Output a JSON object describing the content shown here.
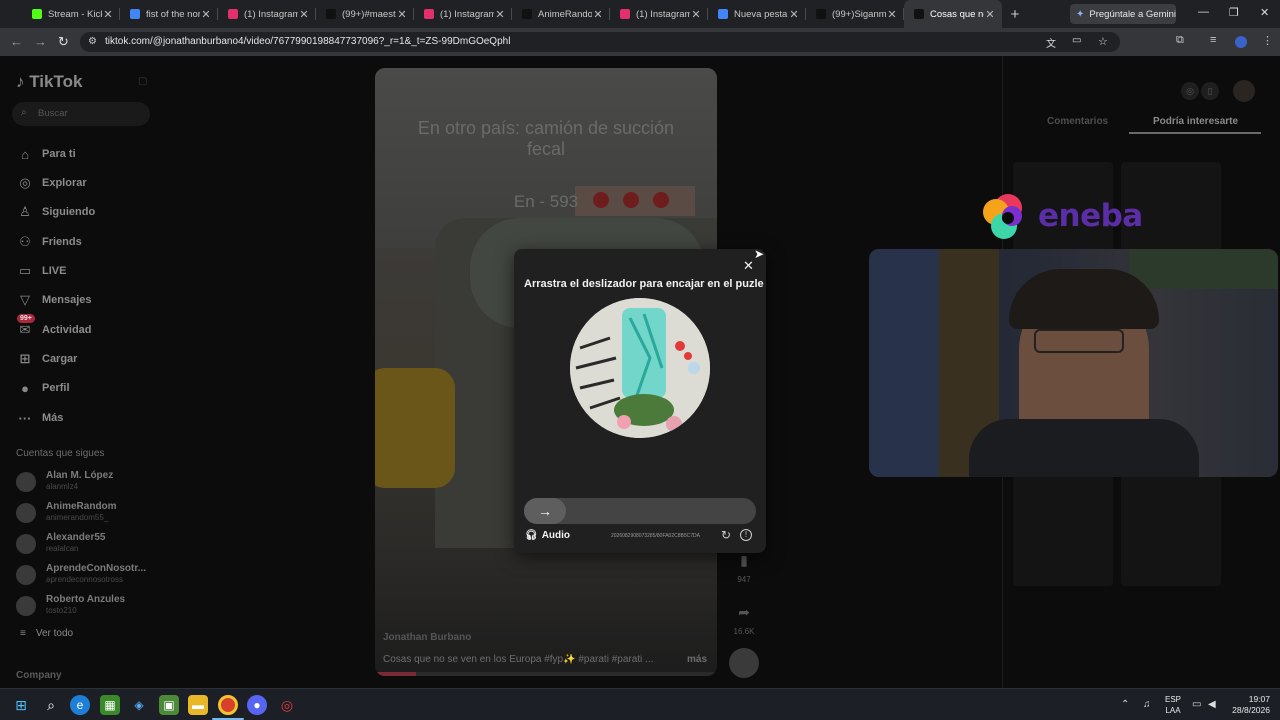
{
  "browser": {
    "tabs": [
      {
        "title": "Stream - Kick",
        "icon": "kick-icon",
        "color": "#53fc18"
      },
      {
        "title": "fist of the nort",
        "icon": "google-icon",
        "color": "#4285f4"
      },
      {
        "title": "(1) Instagram",
        "icon": "instagram-icon",
        "color": "#e1306c"
      },
      {
        "title": "(99+)#maestr",
        "icon": "tiktok-icon",
        "color": "#111111"
      },
      {
        "title": "(1) Instagram",
        "icon": "instagram-icon",
        "color": "#e1306c"
      },
      {
        "title": "AnimeRandom",
        "icon": "tiktok-icon",
        "color": "#111111"
      },
      {
        "title": "(1) Instagram",
        "icon": "instagram-icon",
        "color": "#e1306c"
      },
      {
        "title": "Nueva pestaña",
        "icon": "chrome-icon",
        "color": "#4285f4"
      },
      {
        "title": "(99+)Siganme",
        "icon": "tiktok-icon",
        "color": "#111111"
      },
      {
        "title": "Cosas que no",
        "icon": "tiktok-icon",
        "color": "#111111"
      }
    ],
    "gemini_label": "Pregúntale a Gemini",
    "url": "tiktok.com/@jonathanburbano4/video/7677990198847737096?_r=1&_t=ZS-99DmGOeQphl"
  },
  "tiktok": {
    "logo": "TikTok",
    "search_placeholder": "Buscar",
    "nav": [
      {
        "label": "Para ti",
        "icon": "home-icon"
      },
      {
        "label": "Explorar",
        "icon": "compass-icon"
      },
      {
        "label": "Siguiendo",
        "icon": "following-icon"
      },
      {
        "label": "Friends",
        "icon": "friends-icon"
      },
      {
        "label": "LIVE",
        "icon": "live-icon"
      },
      {
        "label": "Mensajes",
        "icon": "messages-icon"
      },
      {
        "label": "Actividad",
        "icon": "activity-icon"
      },
      {
        "label": "Cargar",
        "icon": "upload-icon"
      },
      {
        "label": "Perfil",
        "icon": "profile-icon"
      },
      {
        "label": "Más",
        "icon": "more-icon"
      }
    ],
    "activity_badge": "99+",
    "following_title": "Cuentas que sigues",
    "accounts": [
      {
        "name": "Alan M. López",
        "handle": "alanmlz4"
      },
      {
        "name": "AnimeRandom",
        "handle": "animerandom55_"
      },
      {
        "name": "Alexander55",
        "handle": "realalcan"
      },
      {
        "name": "AprendeConNosotr...",
        "handle": "aprendeconnosotross"
      },
      {
        "name": "Roberto Anzules",
        "handle": "tosto210"
      }
    ],
    "see_all": "Ver todo",
    "company": "Company",
    "video": {
      "overlay_text_1": "En otro país: camión de succión fecal",
      "overlay_text_2": "En - 593",
      "author": "Jonathan Burbano",
      "caption": "Cosas que no se ven en los Europa #fyp✨ #parati #parati ...",
      "more": "más",
      "progress": 0.12
    },
    "actions": [
      {
        "icon": "comment-icon",
        "count": "79"
      },
      {
        "icon": "bookmark-icon",
        "count": "947"
      },
      {
        "icon": "share-icon",
        "count": "16.6K"
      }
    ],
    "right_tabs": {
      "comments": "Comentarios",
      "suggested": "Podría interesarte"
    }
  },
  "captcha": {
    "title": "Arrastra el deslizador para encajar en el puzle",
    "audio_label": "Audio",
    "id_text": "2026082908073285/80FA02C8B5C7DA",
    "slider_arrow": "→"
  },
  "overlay": {
    "sponsor_logo": "eneba"
  },
  "taskbar": {
    "lang_1": "ESP",
    "lang_2": "LAA",
    "time": "19:07",
    "date": "28/8/2026"
  }
}
